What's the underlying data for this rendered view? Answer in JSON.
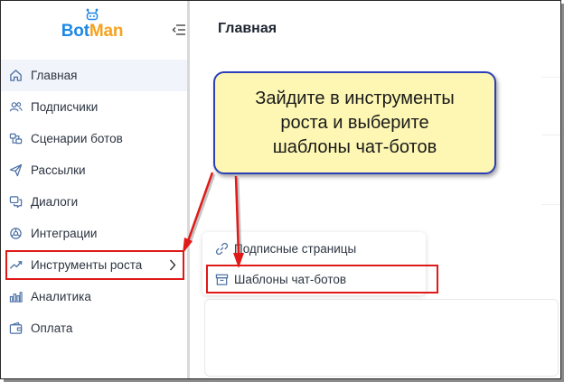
{
  "brand": {
    "part1": "Bot",
    "part2": "Man",
    "bot_color": "#1e88e5",
    "man_color": "#f6a21e"
  },
  "sidebar": {
    "items": [
      {
        "label": "Главная",
        "icon": "home-icon"
      },
      {
        "label": "Подписчики",
        "icon": "users-icon"
      },
      {
        "label": "Сценарии ботов",
        "icon": "scenario-icon"
      },
      {
        "label": "Рассылки",
        "icon": "send-icon"
      },
      {
        "label": "Диалоги",
        "icon": "chat-icon"
      },
      {
        "label": "Интеграции",
        "icon": "integration-icon"
      },
      {
        "label": "Инструменты роста",
        "icon": "growth-icon"
      },
      {
        "label": "Аналитика",
        "icon": "analytics-icon"
      },
      {
        "label": "Оплата",
        "icon": "wallet-icon"
      }
    ]
  },
  "main": {
    "title": "Главная"
  },
  "submenu": {
    "items": [
      {
        "label": "Подписные страницы",
        "icon": "link-icon"
      },
      {
        "label": "Шаблоны чат-ботов",
        "icon": "archive-icon"
      }
    ]
  },
  "callout": {
    "line1": "Зайдите в инструменты",
    "line2": "роста и выберите",
    "line3": "шаблоны чат-ботов"
  },
  "colors": {
    "highlight": "#e01919",
    "callout_border": "#2a3fb8",
    "callout_fill": "#fdf7b3",
    "active_bg": "#f1f4fa"
  }
}
